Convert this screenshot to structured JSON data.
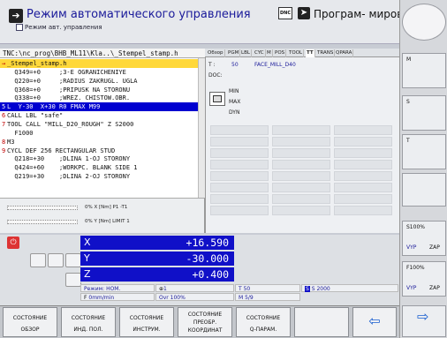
{
  "header": {
    "mode_title": "Режим автоматического управления",
    "mode_subtitle": "Режим авт. управления",
    "dnc_label": "DNC",
    "program_title": "Програм- мирован..."
  },
  "program": {
    "path": "TNC:\\nc_prog\\BHB_ML11\\Kla..\\_Stempel_stamp.h",
    "lines": [
      {
        "num": "→",
        "text": "_Stempel_stamp.h",
        "style": "first"
      },
      {
        "num": "",
        "text": "  Q349=+0     ;3-E OGRANICHENIYE"
      },
      {
        "num": "",
        "text": "  Q220=+0     ;RADIUS ZAKRUGL. UGLA"
      },
      {
        "num": "",
        "text": "  Q368=+0     ;PRIPUSK NA STORONU"
      },
      {
        "num": "",
        "text": "  Q338=+0     ;WREZ. CHISTOW.OBR."
      },
      {
        "num": "5",
        "text": "L  Y-30  X+30 R0 FMAX M99",
        "style": "active"
      },
      {
        "num": "6",
        "text": "CALL LBL \"safe\""
      },
      {
        "num": "7",
        "text": "TOOL CALL \"MILL_D20_ROUGH\" Z S2000"
      },
      {
        "num": "",
        "text": "  F1000"
      },
      {
        "num": "8",
        "text": "M3"
      },
      {
        "num": "9",
        "text": "CYCL DEF 256 RECTANGULAR STUD"
      },
      {
        "num": "",
        "text": "  Q218=+30    ;DLINA 1-OJ STORONY"
      },
      {
        "num": "",
        "text": "  Q424=+60    ;WORKPC. BLANK SIDE 1"
      },
      {
        "num": "",
        "text": "  Q219=+30    ;DLINA 2-OJ STORONY"
      }
    ]
  },
  "mini_status": {
    "line1": "0% X [Nm]  P1  -T1",
    "line2": "0% Y [Nm]  LIMIT 1"
  },
  "status_tabs": {
    "tabs": [
      "Обзор",
      "PGM",
      "LBL",
      "CYC",
      "M",
      "POS",
      "TOOL",
      "TT",
      "TRANS",
      "QPARA"
    ],
    "active_tab": "TT",
    "t_label": "T :",
    "t_number": "50",
    "tool_name": "FACE_MILL_D40",
    "doc_label": "DOC:",
    "min_label": "MIN",
    "max_label": "MAX",
    "dyn_label": "DYN"
  },
  "positions": {
    "axes": [
      {
        "axis": "X",
        "value": "+16.590"
      },
      {
        "axis": "Y",
        "value": "-30.000"
      },
      {
        "axis": "Z",
        "value": "+0.400"
      }
    ],
    "mode_label": "Режим: НОМ.",
    "tool_field": "1",
    "tool_t": "T 50",
    "spindle": "S 2000",
    "feed": "0mm/min",
    "override": "Ovr 100%",
    "mfunc": "M 5/9"
  },
  "right_softkeys": {
    "m_label": "M",
    "s_label": "S",
    "t_label": "T",
    "s100": "S100%",
    "zap1": "ZAP",
    "vyp1": "VYP",
    "f100": "F100%",
    "zap2": "ZAP",
    "vyp2": "VYP"
  },
  "softkeys": [
    {
      "l1": "СОСТОЯНИЕ",
      "l2": "ОБЗОР"
    },
    {
      "l1": "СОСТОЯНИЕ",
      "l2": "ИНД. ПОЛ."
    },
    {
      "l1": "СОСТОЯНИЕ",
      "l2": "ИНСТРУМ."
    },
    {
      "l1": "СОСТОЯНИЕ",
      "l2": "ПРЕОБР.",
      "l3": "КООРДИНАТ"
    },
    {
      "l1": "СОСТОЯНИЕ",
      "l2": "Q-ПАРАМ."
    }
  ],
  "colors": {
    "active_line": "#0000d0",
    "axis_bg": "#1010c8",
    "line_number": "#c00000"
  }
}
